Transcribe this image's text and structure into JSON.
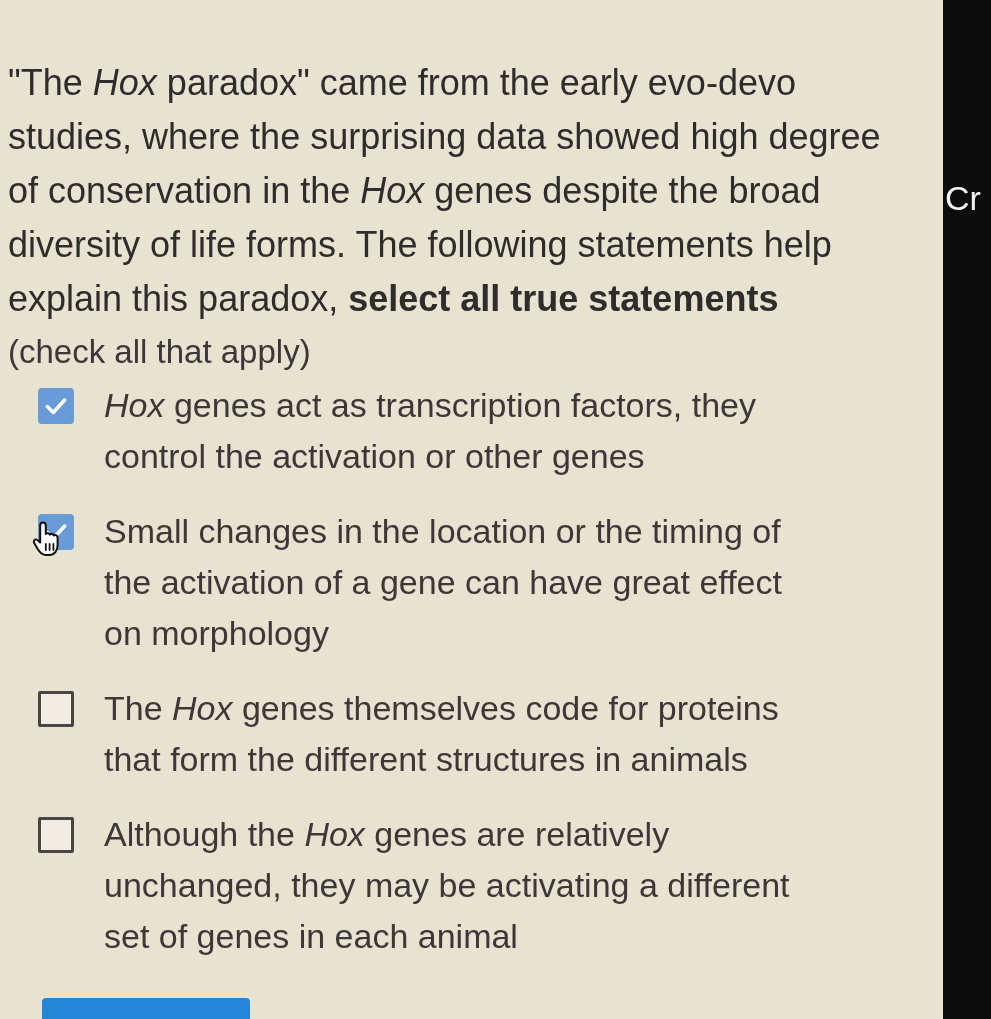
{
  "question": {
    "text": "\"The *Hox* paradox\" came from the early evo-devo studies, where the surprising data showed high degree of conservation in the *Hox* genes despite the broad diversity of life forms. The following statements help explain this paradox, **select all true statements**",
    "hint": "(check all that apply)"
  },
  "options": [
    {
      "label": "*Hox* genes act as transcription factors, they control the activation or other genes",
      "checked": true,
      "hovered": false
    },
    {
      "label": "Small changes in the location or the timing of the activation of a gene can have great effect on morphology",
      "checked": true,
      "hovered": true
    },
    {
      "label": "The *Hox* genes themselves code for proteins that form the different structures in animals",
      "checked": false,
      "hovered": false
    },
    {
      "label": "Although the *Hox* genes are relatively unchanged, they may be activating a different set of genes in each animal",
      "checked": false,
      "hovered": false
    }
  ],
  "side_panel": {
    "text": "Cr"
  }
}
